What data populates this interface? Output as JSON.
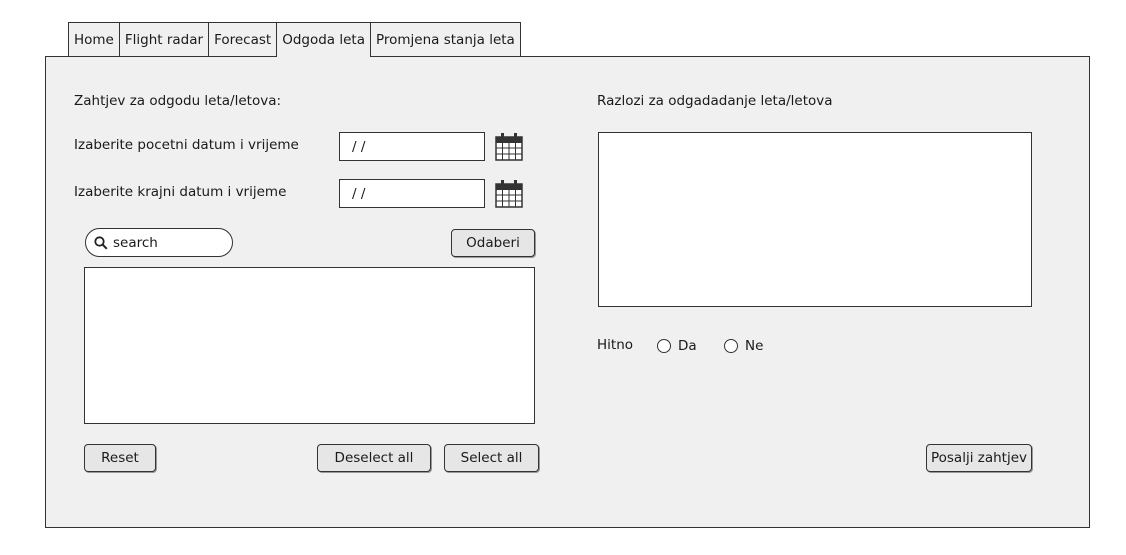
{
  "tabs": [
    {
      "label": "Home"
    },
    {
      "label": "Flight radar"
    },
    {
      "label": "Forecast"
    },
    {
      "label": "Odgoda leta"
    },
    {
      "label": "Promjena stanja leta"
    }
  ],
  "left": {
    "heading": "Zahtjev za odgodu leta/letova:",
    "start_label": "Izaberite pocetni datum i vrijeme",
    "start_value": "/ /",
    "end_label": "Izaberite krajni datum i vrijeme",
    "end_value": "/ /",
    "search_placeholder": "search",
    "select_button": "Odaberi",
    "reset_button": "Reset",
    "deselect_all_button": "Deselect all",
    "select_all_button": "Select all"
  },
  "right": {
    "heading": "Razlozi za odgadadanje leta/letova",
    "urgent_label": "Hitno",
    "option_yes": "Da",
    "option_no": "Ne",
    "submit_button": "Posalji zahtjev"
  }
}
